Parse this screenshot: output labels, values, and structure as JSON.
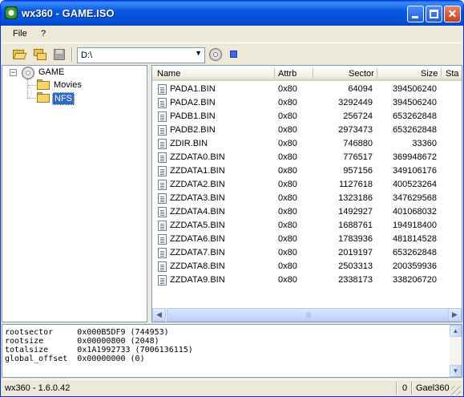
{
  "window": {
    "title": "wx360 - GAME.ISO",
    "buttons": {
      "minimize_icon": "minimize-icon",
      "maximize_icon": "maximize-icon",
      "close_glyph": "✕"
    }
  },
  "menu": {
    "file": "File",
    "help": "?"
  },
  "toolbar": {
    "drive": "D:\\",
    "drive_arrow": "▼",
    "icons": [
      "folder-open-icon",
      "folders-icon",
      "save-icon",
      "disc-icon",
      "stop-icon"
    ]
  },
  "tree": {
    "expander": "−",
    "root": "GAME",
    "children": [
      "Movies",
      "NFS"
    ],
    "selected": "NFS"
  },
  "list": {
    "columns": {
      "name": "Name",
      "attrib": "Attrb",
      "sector": "Sector",
      "size": "Size",
      "status": "Sta"
    },
    "rows": [
      {
        "name": "PADA1.BIN",
        "attrib": "0x80",
        "sector": "64094",
        "size": "394506240"
      },
      {
        "name": "PADA2.BIN",
        "attrib": "0x80",
        "sector": "3292449",
        "size": "394506240"
      },
      {
        "name": "PADB1.BIN",
        "attrib": "0x80",
        "sector": "256724",
        "size": "653262848"
      },
      {
        "name": "PADB2.BIN",
        "attrib": "0x80",
        "sector": "2973473",
        "size": "653262848"
      },
      {
        "name": "ZDIR.BIN",
        "attrib": "0x80",
        "sector": "746880",
        "size": "33360"
      },
      {
        "name": "ZZDATA0.BIN",
        "attrib": "0x80",
        "sector": "776517",
        "size": "369948672"
      },
      {
        "name": "ZZDATA1.BIN",
        "attrib": "0x80",
        "sector": "957156",
        "size": "349106176"
      },
      {
        "name": "ZZDATA2.BIN",
        "attrib": "0x80",
        "sector": "1127618",
        "size": "400523264"
      },
      {
        "name": "ZZDATA3.BIN",
        "attrib": "0x80",
        "sector": "1323186",
        "size": "347629568"
      },
      {
        "name": "ZZDATA4.BIN",
        "attrib": "0x80",
        "sector": "1492927",
        "size": "401068032"
      },
      {
        "name": "ZZDATA5.BIN",
        "attrib": "0x80",
        "sector": "1688761",
        "size": "194918400"
      },
      {
        "name": "ZZDATA6.BIN",
        "attrib": "0x80",
        "sector": "1783936",
        "size": "481814528"
      },
      {
        "name": "ZZDATA7.BIN",
        "attrib": "0x80",
        "sector": "2019197",
        "size": "653262848"
      },
      {
        "name": "ZZDATA8.BIN",
        "attrib": "0x80",
        "sector": "2503313",
        "size": "200359936"
      },
      {
        "name": "ZZDATA9.BIN",
        "attrib": "0x80",
        "sector": "2338173",
        "size": "338206720"
      }
    ],
    "scroll_left": "◀",
    "scroll_right": "▶",
    "thumb_grip": "|||"
  },
  "console": {
    "lines": [
      "rootsector     0x000B5DF9 (744953)",
      "rootsize       0x00000800 (2048)",
      "totalsize      0x1A1992733 (7006136115)",
      "global_offset  0x00000000 (0)"
    ],
    "scroll_up": "▲",
    "scroll_down": "▼"
  },
  "status": {
    "version": "wx360 - 1.6.0.42",
    "count": "0",
    "author": "Gael360"
  },
  "colors": {
    "titlebar": "#0550D6",
    "selection": "#316AC5",
    "window_bg": "#ECE9D8"
  }
}
